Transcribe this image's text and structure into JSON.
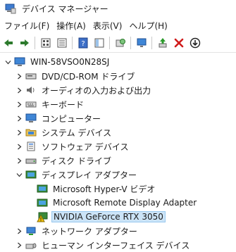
{
  "window": {
    "title": "デバイス マネージャー"
  },
  "menu": [
    "ファイル(F)",
    "操作(A)",
    "表示(V)",
    "ヘルプ(H)"
  ],
  "toolbar": [
    {
      "name": "back-arrow-icon"
    },
    {
      "name": "forward-arrow-icon"
    },
    {
      "sep": true
    },
    {
      "name": "properties-grid-icon"
    },
    {
      "name": "properties-list-icon"
    },
    {
      "sep": true
    },
    {
      "name": "help-icon"
    },
    {
      "name": "view-panel-icon"
    },
    {
      "sep": true
    },
    {
      "name": "scan-hardware-icon"
    },
    {
      "sep": true
    },
    {
      "name": "monitor-icon"
    },
    {
      "sep": true
    },
    {
      "name": "enable-device-icon"
    },
    {
      "name": "uninstall-icon"
    },
    {
      "name": "update-driver-icon"
    }
  ],
  "tree": {
    "root": "WIN-58VSO0N28SJ",
    "categories": [
      {
        "label": "DVD/CD-ROM ドライブ",
        "icon": "dvd-drive-icon",
        "expanded": false
      },
      {
        "label": "オーディオの入力および出力",
        "icon": "speaker-icon",
        "expanded": false
      },
      {
        "label": "キーボード",
        "icon": "keyboard-icon",
        "expanded": false
      },
      {
        "label": "コンピューター",
        "icon": "computer-icon",
        "expanded": false
      },
      {
        "label": "システム デバイス",
        "icon": "system-folder-icon",
        "expanded": false
      },
      {
        "label": "ソフトウェア デバイス",
        "icon": "software-device-icon",
        "expanded": false
      },
      {
        "label": "ディスク ドライブ",
        "icon": "disk-drive-icon",
        "expanded": false
      },
      {
        "label": "ディスプレイ アダプター",
        "icon": "display-adapter-icon",
        "expanded": true,
        "children": [
          {
            "label": "Microsoft Hyper-V ビデオ",
            "icon": "display-adapter-icon",
            "warning": false
          },
          {
            "label": "Microsoft Remote Display Adapter",
            "icon": "display-adapter-icon",
            "warning": false
          },
          {
            "label": "NVIDIA GeForce RTX 3050",
            "icon": "display-adapter-warning-icon",
            "warning": true,
            "selected": true
          }
        ]
      },
      {
        "label": "ネットワーク アダプター",
        "icon": "network-adapter-icon",
        "expanded": false
      },
      {
        "label": "ヒューマン インターフェイス デバイス",
        "icon": "hid-icon",
        "expanded": false
      }
    ]
  },
  "colors": {
    "selection": "#cce4f7",
    "warning": "#f2c200",
    "accent": "#1f6fc5"
  }
}
